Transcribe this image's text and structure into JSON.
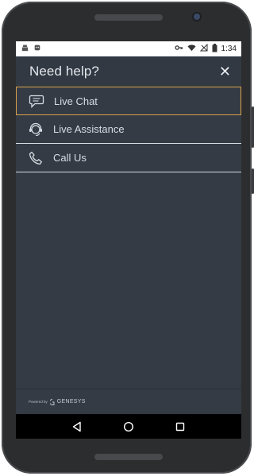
{
  "status_bar": {
    "time": "1:34",
    "left_icons": [
      "android-icon",
      "android-debug-icon"
    ],
    "right_icons": [
      "key-icon",
      "wifi-icon",
      "no-signal-icon",
      "battery-icon"
    ]
  },
  "header": {
    "title": "Need help?",
    "close_symbol": "✕"
  },
  "menu": {
    "items": [
      {
        "label": "Live Chat",
        "icon": "chat-bubble-icon",
        "active": true
      },
      {
        "label": "Live Assistance",
        "icon": "headset-icon",
        "active": false
      },
      {
        "label": "Call Us",
        "icon": "phone-icon",
        "active": false
      }
    ]
  },
  "footer": {
    "powered_by": "Powered by",
    "brand": "GENESYS"
  },
  "colors": {
    "background": "#343b45",
    "active_border": "#d9a24a",
    "divider": "#d8dbe0",
    "text": "#d9dde3"
  }
}
